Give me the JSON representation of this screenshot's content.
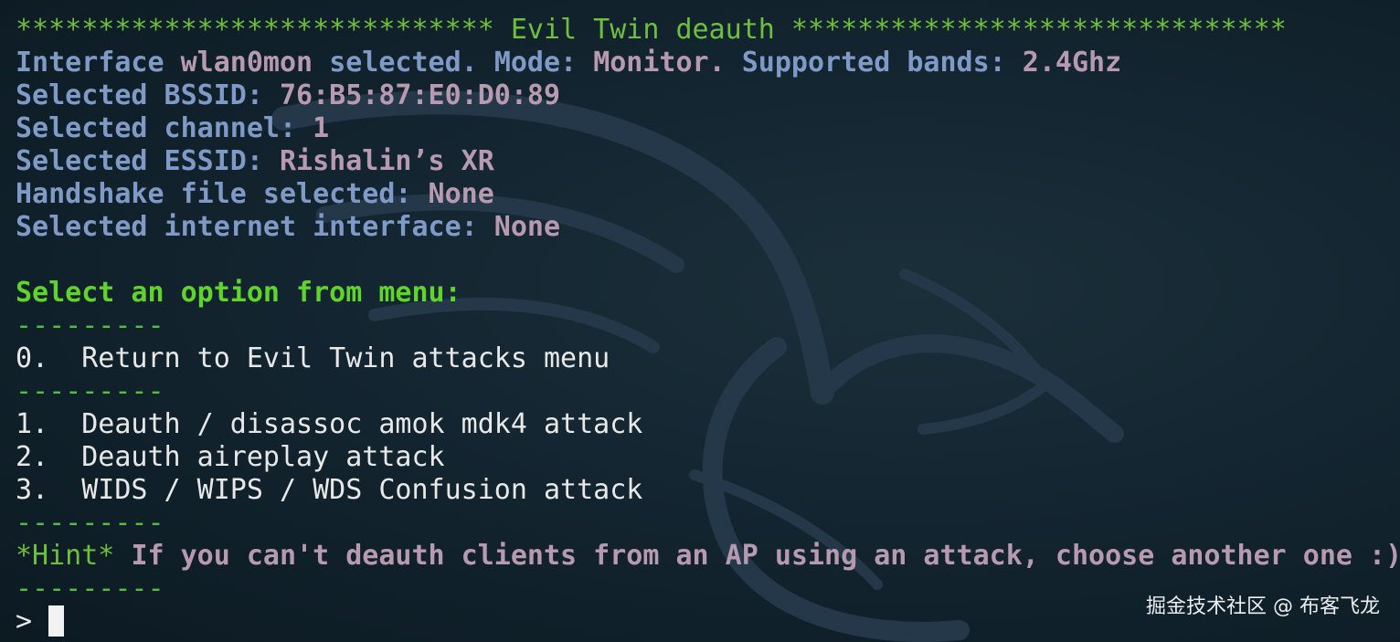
{
  "header": {
    "stars_left": "*****************************",
    "title": "Evil Twin deauth",
    "stars_right": "******************************"
  },
  "info": {
    "interface_label": "Interface",
    "interface_value": "wlan0mon",
    "selected_word": "selected.",
    "mode_label": "Mode:",
    "mode_value": "Monitor.",
    "bands_label": "Supported bands:",
    "bands_value": "2.4Ghz",
    "bssid_label": "Selected BSSID:",
    "bssid_value": "76:B5:87:E0:D0:89",
    "channel_label": "Selected channel:",
    "channel_value": "1",
    "essid_label": "Selected ESSID:",
    "essid_value": "Rishalin’s XR",
    "handshake_label": "Handshake file selected:",
    "handshake_value": "None",
    "internet_label": "Selected internet interface:",
    "internet_value": "None"
  },
  "menu": {
    "prompt": "Select an option from menu:",
    "separator": "---------",
    "options": [
      {
        "num": "0.",
        "label": "Return to Evil Twin attacks menu"
      },
      {
        "num": "1.",
        "label": "Deauth / disassoc amok mdk4 attack"
      },
      {
        "num": "2.",
        "label": "Deauth aireplay attack"
      },
      {
        "num": "3.",
        "label": "WIDS / WIPS / WDS Confusion attack"
      }
    ],
    "hint_tag": "*Hint*",
    "hint_text": "If you can't deauth clients from an AP using an attack, choose another one :)"
  },
  "input": {
    "prompt_char": ">"
  },
  "watermark": "掘金技术社区 @ 布客飞龙",
  "colors": {
    "background": "#132530",
    "green_bright": "#5fd42a",
    "blue": "#7f9ac6",
    "mauve": "#b89ab0",
    "white": "#e8e8e8"
  },
  "icons": {
    "background_logo": "kali-dragon-icon",
    "cursor": "block-cursor"
  }
}
